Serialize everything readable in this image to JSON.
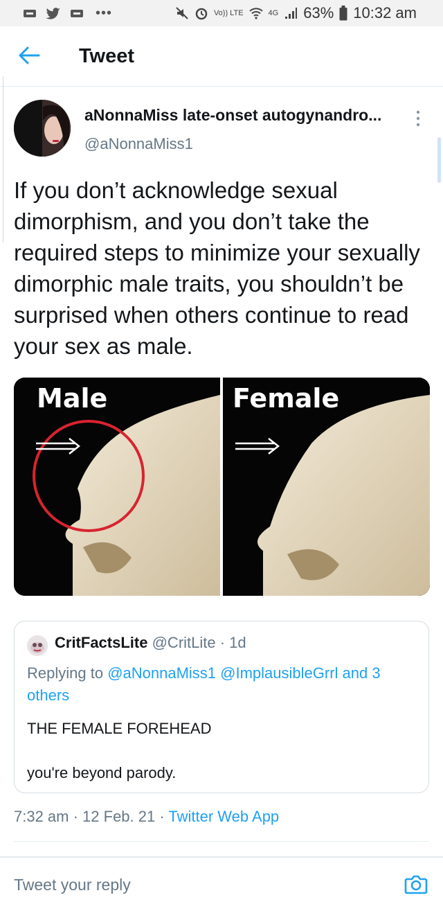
{
  "status_bar": {
    "battery": "63%",
    "time": "10:32 am",
    "network": "4G",
    "volte": "Vo)) LTE",
    "icons": [
      "app-notification-icon",
      "twitter-bird-icon",
      "app-notification-icon",
      "mute-icon",
      "alarm-icon",
      "wifi-icon",
      "signal-icon",
      "battery-icon"
    ]
  },
  "header": {
    "title": "Tweet"
  },
  "tweet": {
    "display_name": "aNonnaMiss late-onset autogynandro...",
    "handle": "@aNonnaMiss1",
    "text": "If you don’t acknowledge sexual dimorphism, and you don’t take the required steps to minimize your sexually dimorphic male traits, you shouldn’t be surprised when others continue to read your sex as male.",
    "image": {
      "left_label": "Male",
      "right_label": "Female"
    },
    "timestamp": "7:32 am · 12 Feb. 21 · ",
    "source": "Twitter Web App"
  },
  "quoted": {
    "name": "CritFactsLite",
    "meta": " @CritLite · 1d",
    "replying_prefix": "Replying to ",
    "replying_to": "@aNonnaMiss1 @ImplausibleGrrl and 3 others",
    "line1": "THE FEMALE FOREHEAD",
    "line2": "you're beyond parody."
  },
  "reply_bar": {
    "placeholder": "Tweet your reply"
  },
  "colors": {
    "accent": "#1da1f2",
    "secondary_text": "#657786",
    "divider": "#e6ecf0"
  }
}
